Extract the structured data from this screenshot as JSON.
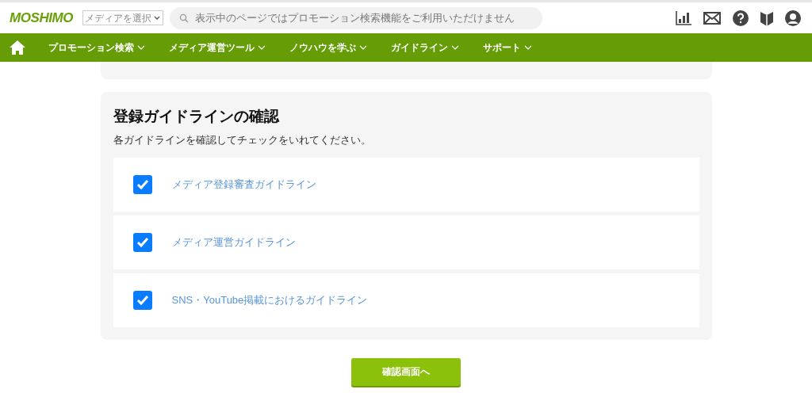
{
  "header": {
    "logo": "MOSHIMO",
    "media_select": "メディアを選択",
    "search": {
      "placeholder": "表示中のページではプロモーション検索機能をご利用いただけません"
    }
  },
  "nav": [
    "プロモーション検索",
    "メディア運営ツール",
    "ノウハウを学ぶ",
    "ガイドライン",
    "サポート"
  ],
  "section": {
    "title": "登録ガイドラインの確認",
    "description": "各ガイドラインを確認してチェックをいれてください。",
    "items": [
      {
        "label": "メディア登録審査ガイドライン",
        "checked": true
      },
      {
        "label": "メディア運営ガイドライン",
        "checked": true
      },
      {
        "label": "SNS・YouTube掲載におけるガイドライン",
        "checked": true
      }
    ]
  },
  "submit": "確認画面へ"
}
